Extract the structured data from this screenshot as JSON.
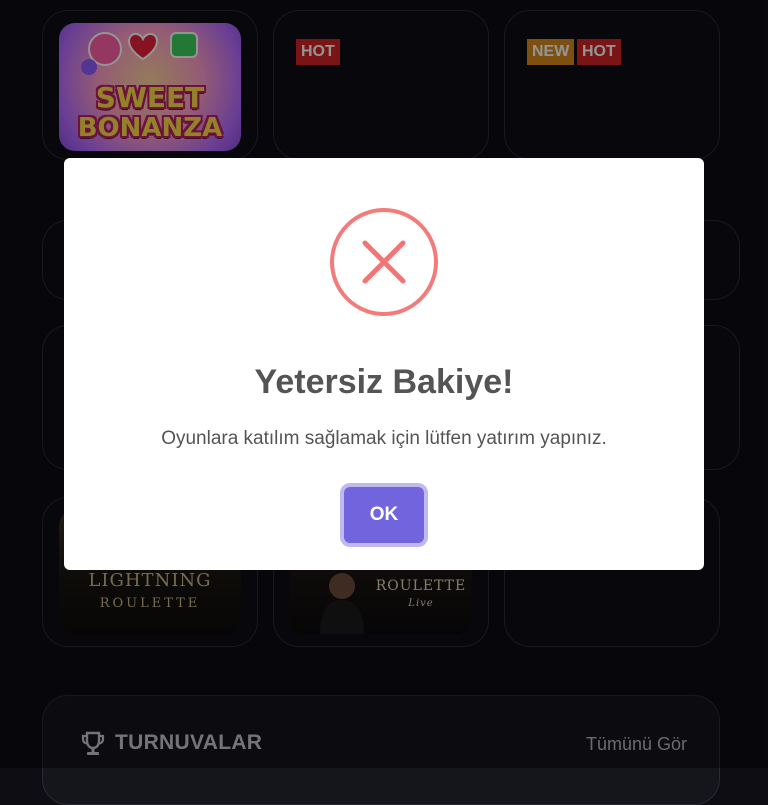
{
  "games": {
    "sweet_bonanza": {
      "line1": "SWEET",
      "line2": "BONANZA"
    },
    "card2": {
      "badge_hot": "HOT"
    },
    "card3": {
      "badge_new": "NEW",
      "badge_hot": "HOT"
    },
    "lightning_roulette": {
      "line1": "LIGHTNING",
      "line2": "ROULETTE"
    },
    "live_roulette": {
      "line1": "ROULETTE",
      "line2": "Live"
    }
  },
  "tournaments": {
    "title": "TURNUVALAR",
    "see_all": "Tümünü Gör",
    "icon": "trophy-icon"
  },
  "modal": {
    "icon": "error-x-icon",
    "title": "Yetersiz Bakiye!",
    "message": "Oyunlara katılım sağlamak için lütfen yatırım yapınız.",
    "ok_label": "OK",
    "colors": {
      "error": "#f27474",
      "button": "#7164dd"
    }
  }
}
